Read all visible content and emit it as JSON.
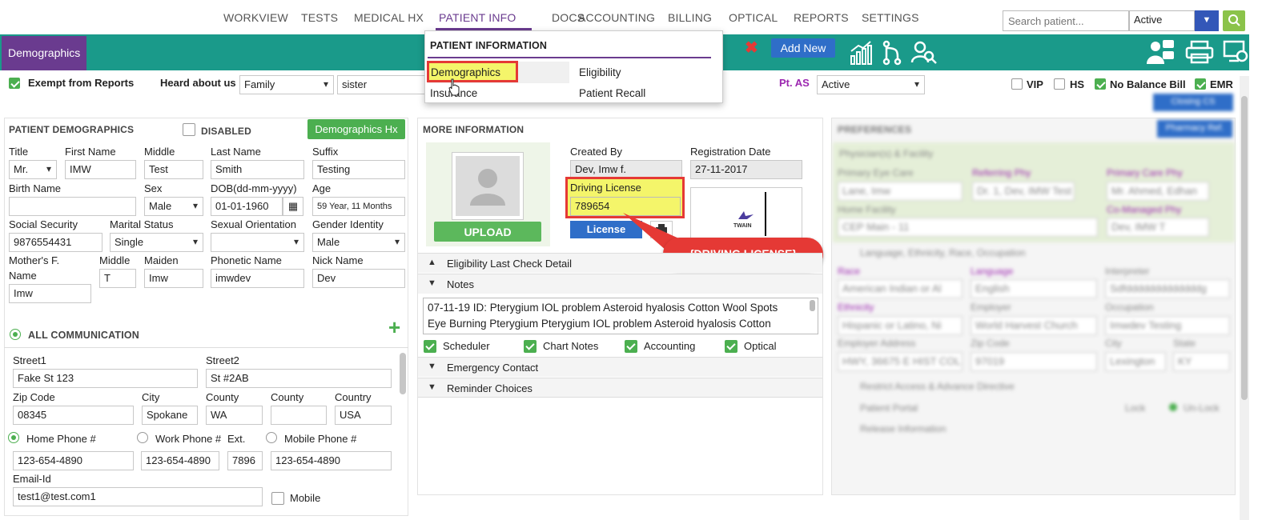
{
  "nav": {
    "items": [
      "WORKVIEW",
      "TESTS",
      "MEDICAL HX",
      "PATIENT INFO",
      "DOCS",
      "ACCOUNTING",
      "BILLING",
      "OPTICAL",
      "REPORTS",
      "SETTINGS"
    ],
    "search_placeholder": "Search patient...",
    "status_value": "Active"
  },
  "toolbar": {
    "tab_label": "Demographics",
    "add_new": "Add New"
  },
  "dropdown": {
    "header": "PATIENT INFORMATION",
    "items": [
      "Demographics",
      "Eligibility",
      "Insurance",
      "Patient Recall"
    ]
  },
  "topbar": {
    "exempt": "Exempt from Reports",
    "heard_label": "Heard about us",
    "heard_value": "Family",
    "heard_detail": "sister",
    "pt_as_label": "Pt. AS",
    "pt_as_value": "Active",
    "vip": "VIP",
    "hs": "HS",
    "no_balance": "No Balance Bill",
    "emr": "EMR"
  },
  "demo": {
    "title": "PATIENT DEMOGRAPHICS",
    "disabled": "DISABLED",
    "hx_button": "Demographics Hx",
    "labels": {
      "title": "Title",
      "first": "First Name",
      "middle": "Middle",
      "last": "Last Name",
      "suffix": "Suffix",
      "birth_name": "Birth Name",
      "sex": "Sex",
      "dob": "DOB(dd-mm-yyyy)",
      "age": "Age",
      "ssn": "Social Security",
      "marital": "Marital Status",
      "orientation": "Sexual Orientation",
      "gender": "Gender Identity",
      "mother1": "Mother's F.",
      "mother2": "Name",
      "middle2": "Middle",
      "maiden": "Maiden",
      "phonetic": "Phonetic Name",
      "nick": "Nick Name"
    },
    "values": {
      "title": "Mr.",
      "first": "IMW",
      "middle": "Test",
      "last": "Smith",
      "suffix": "Testing",
      "birth_name": "",
      "sex": "Male",
      "dob": "01-01-1960",
      "age": "59 Year, 11 Months",
      "ssn": "9876554431",
      "marital": "Single",
      "orientation": "",
      "gender": "Male",
      "mother": "Imw",
      "middle2": "T",
      "maiden": "Imw",
      "phonetic": "imwdev",
      "nick": "Dev"
    }
  },
  "comm": {
    "title": "ALL COMMUNICATION",
    "labels": {
      "street1": "Street1",
      "street2": "Street2",
      "zip": "Zip Code",
      "city": "City",
      "county": "County",
      "county2": "County",
      "country": "Country",
      "home": "Home Phone #",
      "work": "Work Phone #",
      "ext": "Ext.",
      "mobile": "Mobile Phone #",
      "email": "Email-Id",
      "mobile_chk": "Mobile"
    },
    "values": {
      "street1": "Fake St 123",
      "street2": "St #2AB",
      "zip": "08345",
      "city": "Spokane",
      "county": "WA",
      "county2": "",
      "country": "USA",
      "home": "123-654-4890",
      "work": "123-654-4890",
      "ext": "7896",
      "mobile": "123-654-4890",
      "email": "test1@test.com1"
    }
  },
  "more": {
    "title": "MORE INFORMATION",
    "upload": "UPLOAD",
    "created_by_label": "Created By",
    "created_by": "Dev, Imw f.",
    "reg_label": "Registration Date",
    "reg_date": "27-11-2017",
    "dl_label": "Driving License",
    "dl_value": "789654",
    "license_btn": "License",
    "callout": "{DRIVING LICENSE}",
    "twain": "TWAIN",
    "accordion": {
      "eligibility": "Eligibility Last Check Detail",
      "notes": "Notes",
      "emergency": "Emergency Contact",
      "reminder": "Reminder Choices"
    },
    "notes_text": "07-11-19 ID: Pterygium IOL problem Asteroid hyalosis Cotton Wool Spots Eye Burning Pterygium Pterygium IOL problem Asteroid hyalosis Cotton",
    "checks": [
      "Scheduler",
      "Chart Notes",
      "Accounting",
      "Optical"
    ]
  },
  "prefs": {
    "title": "PREFERENCES",
    "pharmacy": "Pharmacy Ref.",
    "closing": "Closing CS",
    "physicians": "Physician(s) & Facility",
    "primary_eye": "Primary Eye Care",
    "referring": "Referring Phy",
    "primary_care": "Primary Care Phy",
    "pe_val": "Lane, Imw",
    "ref_val": "Dr. 1, Dev, IMW Test",
    "pc_val": "Mr. Ahmed, Edhan",
    "home_fac": "Home Facility",
    "co_managed": "Co-Managed Phy",
    "hf_val": "CEP Main - 11",
    "cm_val": "Dev, IMW T",
    "lang_sec": "Language, Ethnicity, Race, Occupation",
    "race": "Race",
    "language": "Language",
    "interpreter": "Interpreter",
    "race_val": "American Indian or Al",
    "lang_val": "English",
    "interp_val": "Sdfdddddddddddddg",
    "ethnicity": "Ethnicity",
    "employer": "Employer",
    "occupation": "Occupation",
    "eth_val": "Hispanic or Latino, Ni",
    "emp_val": "World Harvest Church",
    "occ_val": "Imwdev Testing",
    "emp_addr": "Employer Address",
    "zip": "Zip Code",
    "city": "City",
    "state": "State",
    "addr_val": "HWY, 36675 E HIST COL",
    "zip_val": "97019",
    "city_val": "Lexington",
    "state_val": "KY",
    "restrict": "Restrict Access & Advance Directive",
    "portal": "Patient Portal",
    "lock": "Lock",
    "unlock": "Un-Lock",
    "release": "Release Information"
  },
  "colors": {
    "teal": "#1a9a8a",
    "purple": "#6a3b8f",
    "green": "#4caf50",
    "blue": "#2f6ec8",
    "red": "#e53935",
    "yellow": "#f4f56a"
  }
}
